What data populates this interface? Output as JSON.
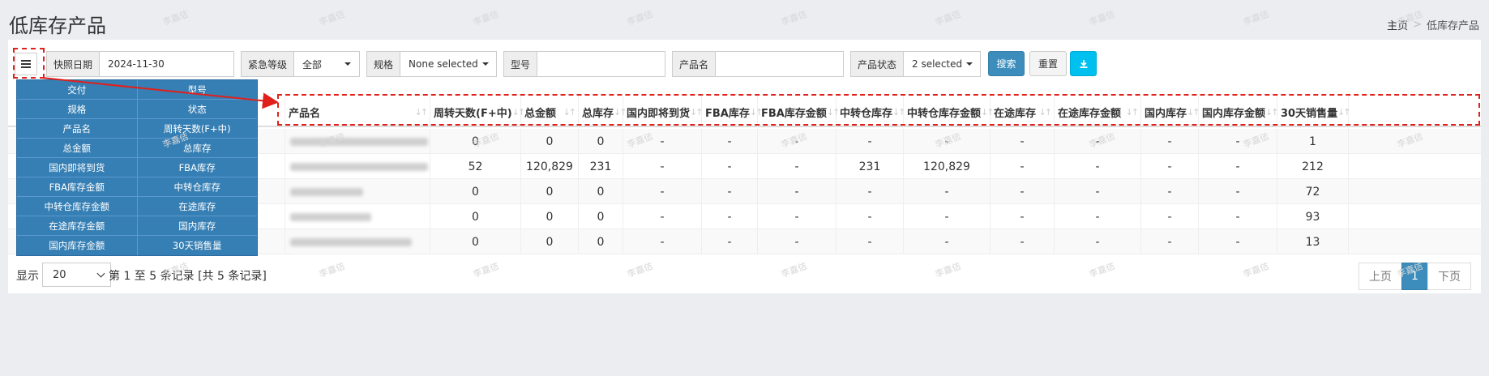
{
  "page": {
    "title": "低库存产品"
  },
  "breadcrumb": {
    "home": "主页",
    "separator": ">",
    "current": "低库存产品"
  },
  "filters": {
    "snapshot_date": {
      "label": "快照日期",
      "value": "2024-11-30"
    },
    "urgency": {
      "label": "紧急等级",
      "value": "全部"
    },
    "spec": {
      "label": "规格",
      "value": "None selected"
    },
    "model": {
      "label": "型号",
      "value": ""
    },
    "product_name": {
      "label": "产品名",
      "value": ""
    },
    "product_status": {
      "label": "产品状态",
      "value": "2 selected"
    }
  },
  "buttons": {
    "search": "搜索",
    "reset": "重置",
    "export_icon": "download-icon"
  },
  "column_menu": [
    [
      "交付",
      "型号"
    ],
    [
      "规格",
      "状态"
    ],
    [
      "产品名",
      "周转天数(F+中)"
    ],
    [
      "总金额",
      "总库存"
    ],
    [
      "国内即将到货",
      "FBA库存"
    ],
    [
      "FBA库存金额",
      "中转仓库存"
    ],
    [
      "中转仓库存金额",
      "在途库存"
    ],
    [
      "在途库存金额",
      "国内库存"
    ],
    [
      "国内库存金额",
      "30天销售量"
    ]
  ],
  "table": {
    "columns": [
      "产品名",
      "周转天数(F+中)",
      "总金额",
      "总库存",
      "国内即将到货",
      "FBA库存",
      "FBA库存金额",
      "中转仓库存",
      "中转仓库存金额",
      "在途库存",
      "在途库存金额",
      "国内库存",
      "国内库存金额",
      "30天销售量"
    ],
    "rows": [
      [
        "0",
        "0",
        "0",
        "-",
        "-",
        "-",
        "-",
        "-",
        "-",
        "-",
        "-",
        "-",
        "1"
      ],
      [
        "52",
        "120,829",
        "231",
        "-",
        "-",
        "-",
        "231",
        "120,829",
        "-",
        "-",
        "-",
        "-",
        "212"
      ],
      [
        "0",
        "0",
        "0",
        "-",
        "-",
        "-",
        "-",
        "-",
        "-",
        "-",
        "-",
        "-",
        "72"
      ],
      [
        "0",
        "0",
        "0",
        "-",
        "-",
        "-",
        "-",
        "-",
        "-",
        "-",
        "-",
        "-",
        "93"
      ],
      [
        "0",
        "0",
        "0",
        "-",
        "-",
        "-",
        "-",
        "-",
        "-",
        "-",
        "-",
        "-",
        "13"
      ]
    ]
  },
  "footer": {
    "show_label": "显示",
    "page_size": "20",
    "info": "第 1 至 5 条记录 [共 5 条记录]",
    "prev": "上页",
    "current_page": "1",
    "next": "下页"
  },
  "watermark_text": "李嘉佶"
}
